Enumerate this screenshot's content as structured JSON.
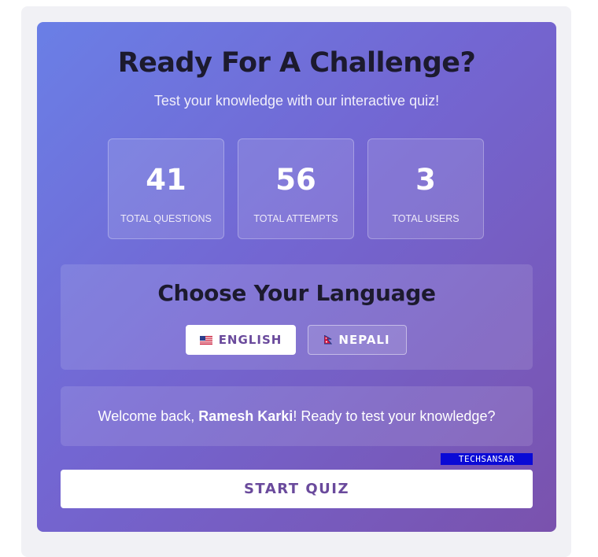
{
  "header": {
    "title": "Ready For A Challenge?",
    "subtitle": "Test your knowledge with our interactive quiz!"
  },
  "stats": [
    {
      "value": "41",
      "label": "TOTAL QUESTIONS"
    },
    {
      "value": "56",
      "label": "TOTAL ATTEMPTS"
    },
    {
      "value": "3",
      "label": "TOTAL USERS"
    }
  ],
  "language": {
    "title": "Choose Your Language",
    "options": [
      {
        "label": "ENGLISH",
        "icon": "us-flag-icon",
        "selected": true
      },
      {
        "label": "NEPALI",
        "icon": "nepal-flag-icon",
        "selected": false
      }
    ]
  },
  "welcome": {
    "prefix": "Welcome back, ",
    "name": "Ramesh Karki",
    "suffix": "! Ready to test your knowledge?"
  },
  "watermark": "TECHSANSAR",
  "start_label": "START QUIZ",
  "colors": {
    "accent": "#6a4a9c",
    "gradient_start": "#6a7fe6",
    "gradient_end": "#7a52ad"
  }
}
